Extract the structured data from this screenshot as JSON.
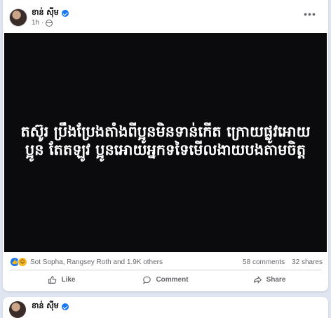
{
  "post": {
    "author": "ខាន់ ស៊ីម",
    "time": "1h",
    "dot": "·",
    "more_icon": "more-horizontal-icon",
    "more_label": "•••",
    "media_text": "តស៊ូរ ប្រឹងប្រែងតាំងពីប្អូនមិនទាន់កើត ក្រោយផ្លូវអោយប្អូន តែតឡូវ ប្អូនអោយអ្នកទទៃមើលងាយបងតាមចិត្ត",
    "reactions": {
      "icons": [
        "like-icon",
        "sad-icon"
      ],
      "names": "Sot Sopha, Rangsey Roth and 1.9K others",
      "comments": "58 comments",
      "shares": "32 shares"
    },
    "actions": {
      "like": "Like",
      "comment": "Comment",
      "share": "Share"
    }
  },
  "next_post": {
    "author": "ខាន់ ស៊ីម"
  },
  "colors": {
    "accent": "#1877f2",
    "background": "#dfe6f1",
    "media_bg": "#0b0b0d",
    "secondary_text": "#65676b"
  }
}
